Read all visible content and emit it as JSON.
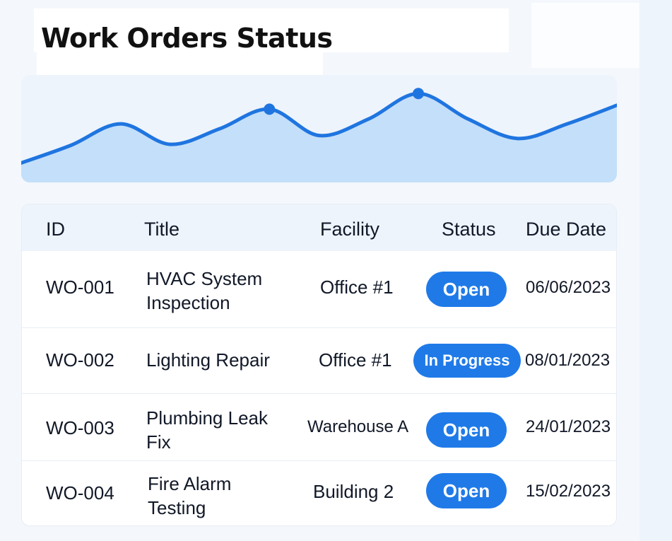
{
  "page": {
    "title": "Work Orders Status"
  },
  "colors": {
    "accent": "#1f7ae8",
    "line": "#1f75e0",
    "area": "#c4dff9",
    "header_bg": "#eef4fc"
  },
  "chart_data": {
    "type": "area",
    "x": [
      0,
      1,
      2,
      3,
      4,
      5,
      6,
      7,
      8,
      9,
      10,
      11,
      12
    ],
    "values": [
      2.0,
      3.8,
      6.0,
      3.9,
      5.5,
      7.5,
      4.8,
      6.5,
      9.1,
      6.5,
      4.5,
      6.0,
      7.9
    ],
    "markers": [
      5,
      8
    ],
    "ylim": [
      0,
      11
    ],
    "title": "",
    "xlabel": "",
    "ylabel": ""
  },
  "table": {
    "headers": [
      "ID",
      "Title",
      "Facility",
      "Status",
      "Due Date"
    ],
    "rows": [
      {
        "id": "WO-001",
        "title": "HVAC System Inspection",
        "facility": "Office #1",
        "status": "Open",
        "due": "06/06/2023"
      },
      {
        "id": "WO-002",
        "title": "Lighting Repair",
        "facility": "Office #1",
        "status": "In Progress",
        "due": "08/01/2023"
      },
      {
        "id": "WO-003",
        "title": "Plumbing Leak Fix",
        "facility": "Warehouse A",
        "status": "Open",
        "due": "24/01/2023"
      },
      {
        "id": "WO-004",
        "title": "Fire Alarm Testing",
        "facility": "Building 2",
        "status": "Open",
        "due": "15/02/2023"
      }
    ]
  }
}
